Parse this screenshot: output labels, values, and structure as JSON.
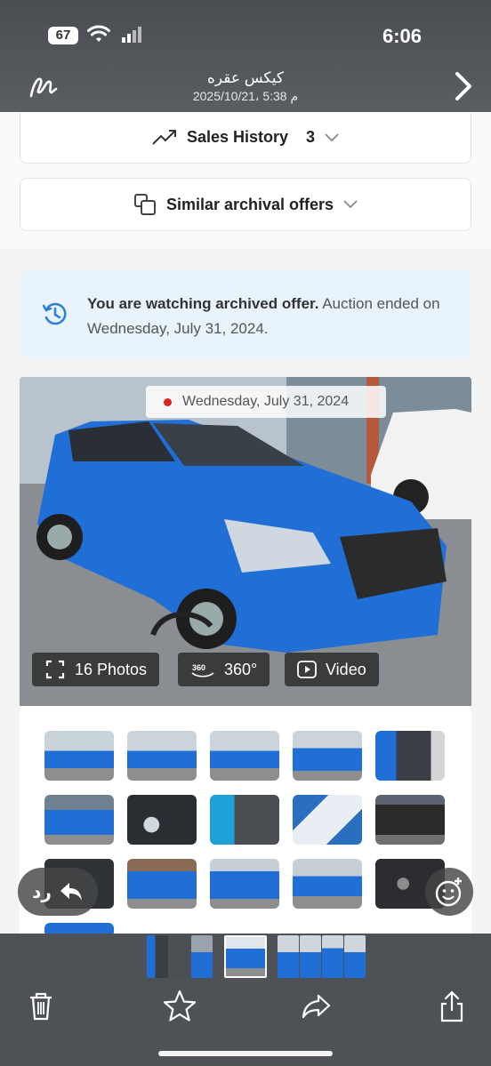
{
  "status_bar": {
    "battery": "67",
    "time": "6:06"
  },
  "header": {
    "title": "كيكس عقره",
    "subtitle": "2025/10/21، 5:38 م"
  },
  "accordions": {
    "sales_history": {
      "label": "Sales History",
      "count": "3"
    },
    "similar_offers": {
      "label": "Similar archival offers"
    }
  },
  "notice": {
    "bold": "You are watching archived offer.",
    "rest": " Auction ended on Wednesday, July 31, 2024."
  },
  "gallery": {
    "date": "Wednesday, July 31, 2024",
    "photos_label": "16 Photos",
    "spin_label": "360°",
    "video_label": "Video"
  },
  "reply_label": "رد",
  "colors": {
    "car_blue": "#1f6fd6",
    "notice_bg": "#e9f3fc",
    "accent_red": "#e02424"
  }
}
